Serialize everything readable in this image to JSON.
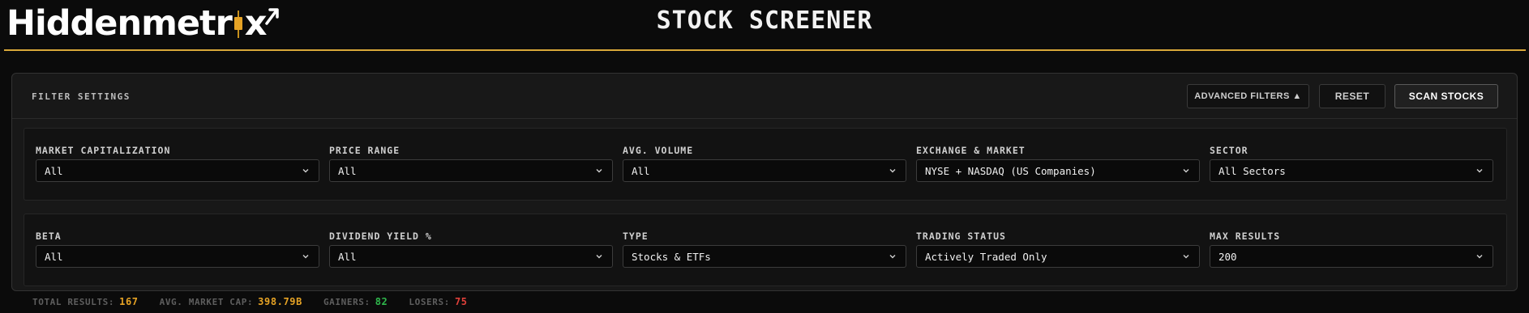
{
  "header": {
    "logo_text_start": "Hiddenmetr",
    "logo_text_end": "x",
    "title": "STOCK SCREENER",
    "accent_color": "#d9a83a"
  },
  "panel": {
    "title": "FILTER SETTINGS",
    "buttons": {
      "advanced": "ADVANCED FILTERS ▲",
      "reset": "RESET",
      "scan": "SCAN STOCKS"
    }
  },
  "filters_row1": [
    {
      "label": "MARKET CAPITALIZATION",
      "value": "All"
    },
    {
      "label": "PRICE RANGE",
      "value": "All"
    },
    {
      "label": "AVG. VOLUME",
      "value": "All"
    },
    {
      "label": "EXCHANGE & MARKET",
      "value": "NYSE + NASDAQ (US Companies)"
    },
    {
      "label": "SECTOR",
      "value": "All Sectors"
    }
  ],
  "filters_row2": [
    {
      "label": "BETA",
      "value": "All"
    },
    {
      "label": "DIVIDEND YIELD %",
      "value": "All"
    },
    {
      "label": "TYPE",
      "value": "Stocks & ETFs"
    },
    {
      "label": "TRADING STATUS",
      "value": "Actively Traded Only"
    },
    {
      "label": "MAX RESULTS",
      "value": "200"
    }
  ],
  "stats": {
    "total_results_label": "TOTAL RESULTS:",
    "total_results": "167",
    "avg_market_cap_label": "AVG. MARKET CAP:",
    "avg_market_cap": "398.79B",
    "gainers_label": "GAINERS:",
    "gainers": "82",
    "losers_label": "LOSERS:",
    "losers": "75",
    "colors": {
      "neutral": "#e6a325",
      "gainers": "#2fb84c",
      "losers": "#e0403a"
    }
  },
  "icons": {
    "select": "chevron-down-icon",
    "logo_arrow": "arrow-up-right-icon",
    "logo_i": "candlestick-icon"
  }
}
